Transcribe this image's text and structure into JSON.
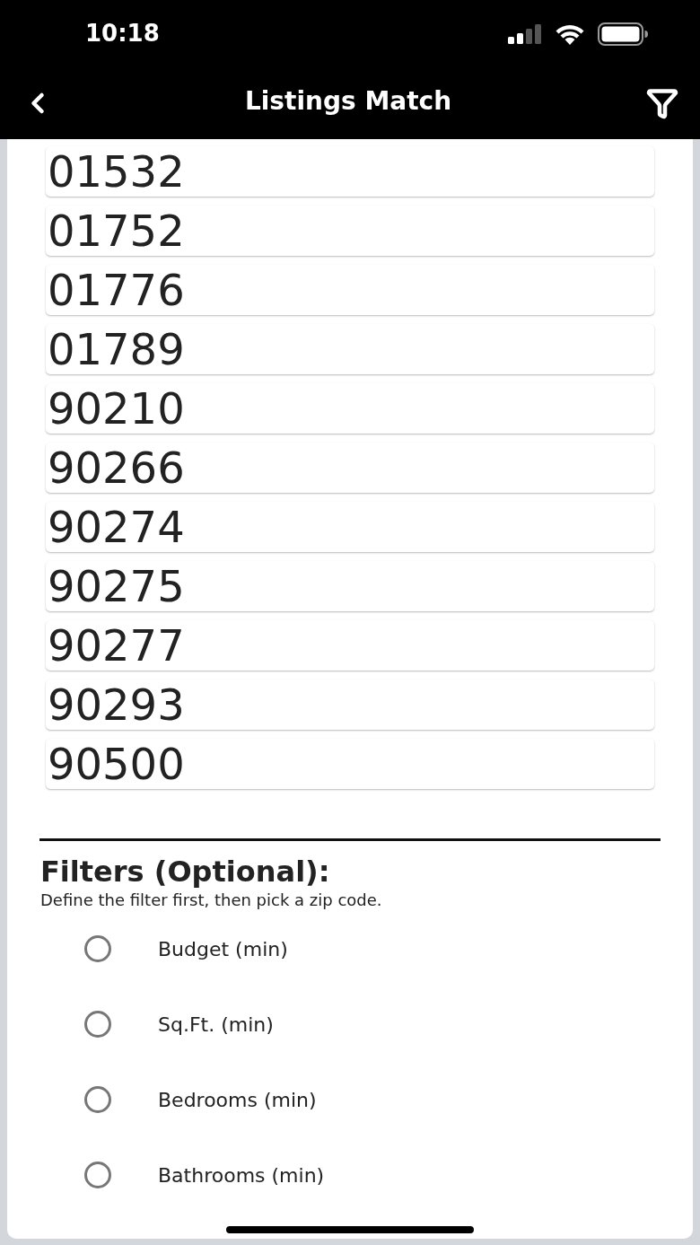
{
  "status_bar": {
    "time": "10:18"
  },
  "nav_bar": {
    "title": "Listings Match"
  },
  "zip_codes": [
    "01532",
    "01752",
    "01776",
    "01789",
    "90210",
    "90266",
    "90274",
    "90275",
    "90277",
    "90293",
    "90500"
  ],
  "filters": {
    "title": "Filters (Optional):",
    "hint": "Define the filter first, then pick a zip code.",
    "options": [
      {
        "label": "Budget (min)",
        "selected": false
      },
      {
        "label": "Sq.Ft. (min)",
        "selected": false
      },
      {
        "label": "Bedrooms (min)",
        "selected": false
      },
      {
        "label": "Bathrooms (min)",
        "selected": false
      }
    ]
  }
}
